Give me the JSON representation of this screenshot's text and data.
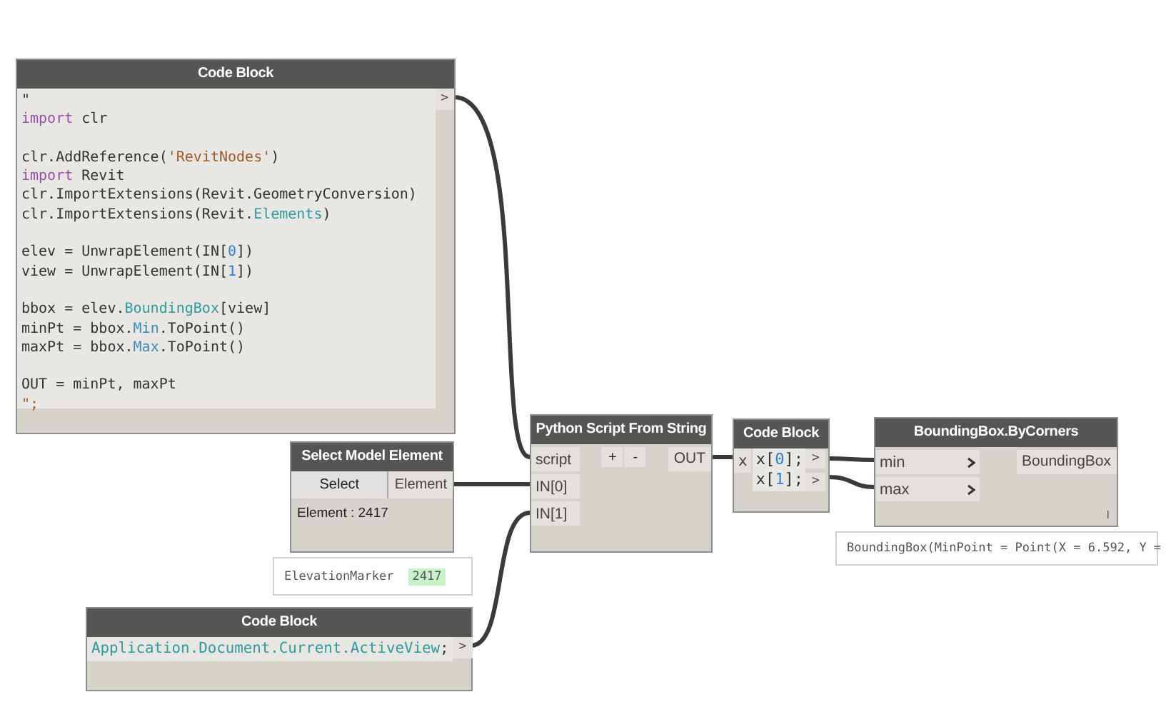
{
  "nodes": [
    {
      "kind": "code",
      "title": "Code Block",
      "groups": [
        [
          [
            {
              "kind": "plain",
              "text": "\""
            }
          ],
          [
            {
              "kind": "keyword",
              "text": "import"
            },
            {
              "kind": "plain",
              "text": " clr"
            }
          ]
        ],
        [
          [
            {
              "kind": "plain",
              "text": "clr.AddReference("
            },
            {
              "kind": "string",
              "text": "'RevitNodes'"
            },
            {
              "kind": "plain",
              "text": ")"
            }
          ],
          [
            {
              "kind": "keyword",
              "text": "import"
            },
            {
              "kind": "plain",
              "text": " Revit"
            }
          ],
          [
            {
              "kind": "plain",
              "text": "clr.ImportExtensions(Revit.GeometryConversion)"
            }
          ],
          [
            {
              "kind": "plain",
              "text": "clr.ImportExtensions(Revit."
            },
            {
              "kind": "member",
              "text": "Elements"
            },
            {
              "kind": "plain",
              "text": ")"
            }
          ]
        ],
        [
          [
            {
              "kind": "plain",
              "text": "elev = UnwrapElement(IN["
            },
            {
              "kind": "number",
              "text": "0"
            },
            {
              "kind": "plain",
              "text": "])"
            }
          ],
          [
            {
              "kind": "plain",
              "text": "view = UnwrapElement(IN["
            },
            {
              "kind": "number",
              "text": "1"
            },
            {
              "kind": "plain",
              "text": "])"
            }
          ]
        ],
        [
          [
            {
              "kind": "plain",
              "text": "bbox = elev."
            },
            {
              "kind": "member",
              "text": "BoundingBox"
            },
            {
              "kind": "plain",
              "text": "[view]"
            }
          ],
          [
            {
              "kind": "plain",
              "text": "minPt = bbox."
            },
            {
              "kind": "property",
              "text": "Min"
            },
            {
              "kind": "plain",
              "text": ".ToPoint()"
            }
          ],
          [
            {
              "kind": "plain",
              "text": "maxPt = bbox."
            },
            {
              "kind": "property",
              "text": "Max"
            },
            {
              "kind": "plain",
              "text": ".ToPoint()"
            }
          ]
        ],
        [
          [
            {
              "kind": "plain",
              "text": "OUT = minPt, maxPt"
            }
          ],
          [
            {
              "kind": "string",
              "text": "\";"
            }
          ]
        ]
      ],
      "outputs": [
        ">"
      ]
    },
    {
      "kind": "select",
      "title": "Select Model Element",
      "button": "Select",
      "outputs": [
        "Element"
      ],
      "info": "Element : 2417",
      "preview": [
        {
          "kind": "plain",
          "text": "ElevationMarker"
        },
        {
          "kind": "value",
          "text": "2417"
        }
      ]
    },
    {
      "kind": "python",
      "title": "Python Script From String",
      "inputs": [
        "script",
        "IN[0]",
        "IN[1]"
      ],
      "buttons": [
        "+",
        "-"
      ],
      "outputs": [
        "OUT"
      ]
    },
    {
      "kind": "code",
      "title": "Code Block",
      "input": "x",
      "groups": [
        [
          [
            {
              "kind": "plain",
              "text": "x["
            },
            {
              "kind": "number",
              "text": "0"
            },
            {
              "kind": "plain",
              "text": "];"
            }
          ],
          [
            {
              "kind": "plain",
              "text": "x["
            },
            {
              "kind": "number",
              "text": "1"
            },
            {
              "kind": "plain",
              "text": "];"
            }
          ]
        ]
      ],
      "outputs": [
        ">",
        ">"
      ]
    },
    {
      "kind": "function",
      "title": "BoundingBox.ByCorners",
      "inputs": [
        "min",
        "max"
      ],
      "outputs": [
        "BoundingBox"
      ],
      "lacing": "I",
      "preview": [
        {
          "kind": "plain",
          "text": "BoundingBox(MinPoint = Point(X = 6.592, Y ="
        }
      ]
    },
    {
      "kind": "code",
      "title": "Code Block",
      "groups": [
        [
          [
            {
              "kind": "member",
              "text": "Application.Document.Current.ActiveView"
            },
            {
              "kind": "plain",
              "text": ";"
            }
          ]
        ]
      ],
      "outputs": [
        ">"
      ]
    }
  ]
}
